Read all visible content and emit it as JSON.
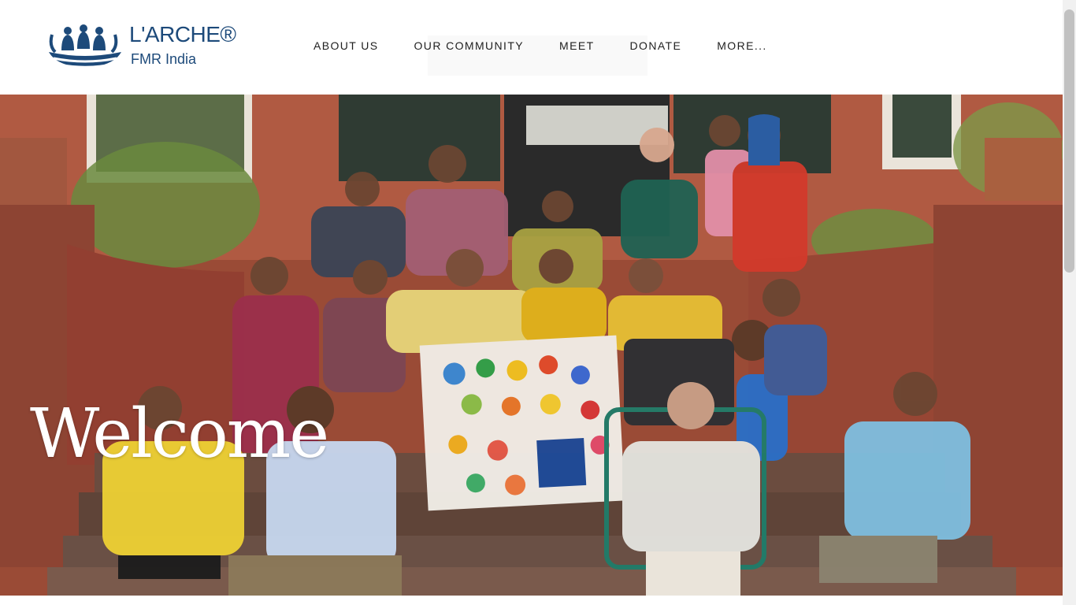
{
  "logo": {
    "brand": "L'ARCHE®",
    "subtitle": "FMR India"
  },
  "nav": {
    "items": [
      "ABOUT US",
      "OUR COMMUNITY",
      "MEET",
      "DONATE",
      "MORE..."
    ]
  },
  "hero": {
    "heading": "Welcome",
    "image": "group-photo-community-on-steps"
  },
  "colors": {
    "brand_blue": "#1d4a7a",
    "nav_text": "#1f1f1f",
    "hero_text": "#ffffff"
  }
}
